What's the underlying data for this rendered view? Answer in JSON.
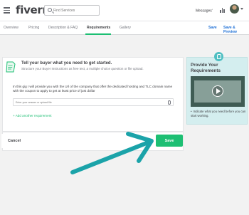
{
  "header": {
    "logo": "fiverr",
    "search": {
      "placeholder": "Find Services"
    },
    "messages_label": "Messages"
  },
  "tabs": [
    {
      "label": "Overview"
    },
    {
      "label": "Pricing"
    },
    {
      "label": "Description & FAQ"
    },
    {
      "label": "Requirements",
      "active": true
    },
    {
      "label": "Gallery"
    }
  ],
  "actions": {
    "save": "Save",
    "save_preview": "Save & Preview"
  },
  "requirements": {
    "title": "Tell your buyer what you need to get started.",
    "subtitle": "Structure your Buyer Instructions as free text, a multiple choice question or file upload.",
    "requirement_text": "In this gig I will provide you with the Url of the company that offer the dedicated hosting and TLC domain name with the coupon to apply to get at least price of just dollar",
    "answer_placeholder": "Enter your answer or upload file",
    "add_requirement": "+ Add another requirement"
  },
  "help_panel": {
    "title": "Provide Your Requirements",
    "note": "Indicate what you need before you can start working."
  },
  "footer": {
    "cancel": "Cancel",
    "save": "Save"
  },
  "colors": {
    "brand_green": "#1dbf73",
    "link_blue": "#1d6fd6",
    "arrow_teal": "#1ba3a9",
    "help_bg": "#d4eeef"
  }
}
